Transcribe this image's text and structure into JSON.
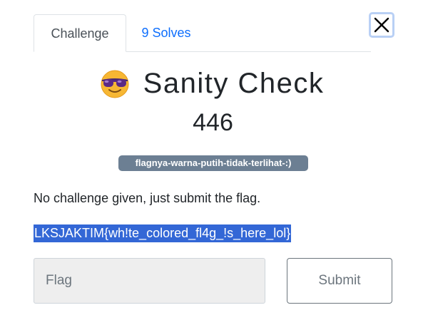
{
  "tabs": [
    {
      "label": "Challenge",
      "active": true
    },
    {
      "label": "9 Solves",
      "active": false
    }
  ],
  "challenge": {
    "icon": "sunglasses-emoji-icon",
    "name": "Sanity Check",
    "points": "446",
    "tag": "flagnya-warna-putih-tidak-terlihat-:)",
    "description": "No challenge given, just submit the flag.",
    "hidden_flag_text": "LKSJAKTIM{wh!te_colored_fl4g_!s_here_lol}"
  },
  "form": {
    "flag_placeholder": "Flag",
    "flag_value": "",
    "submit_label": "Submit"
  },
  "colors": {
    "link": "#0d6efd",
    "tag_background": "#6c7f93",
    "selection_highlight": "#3367d6",
    "close_focus_ring": "#b9d0f5"
  }
}
